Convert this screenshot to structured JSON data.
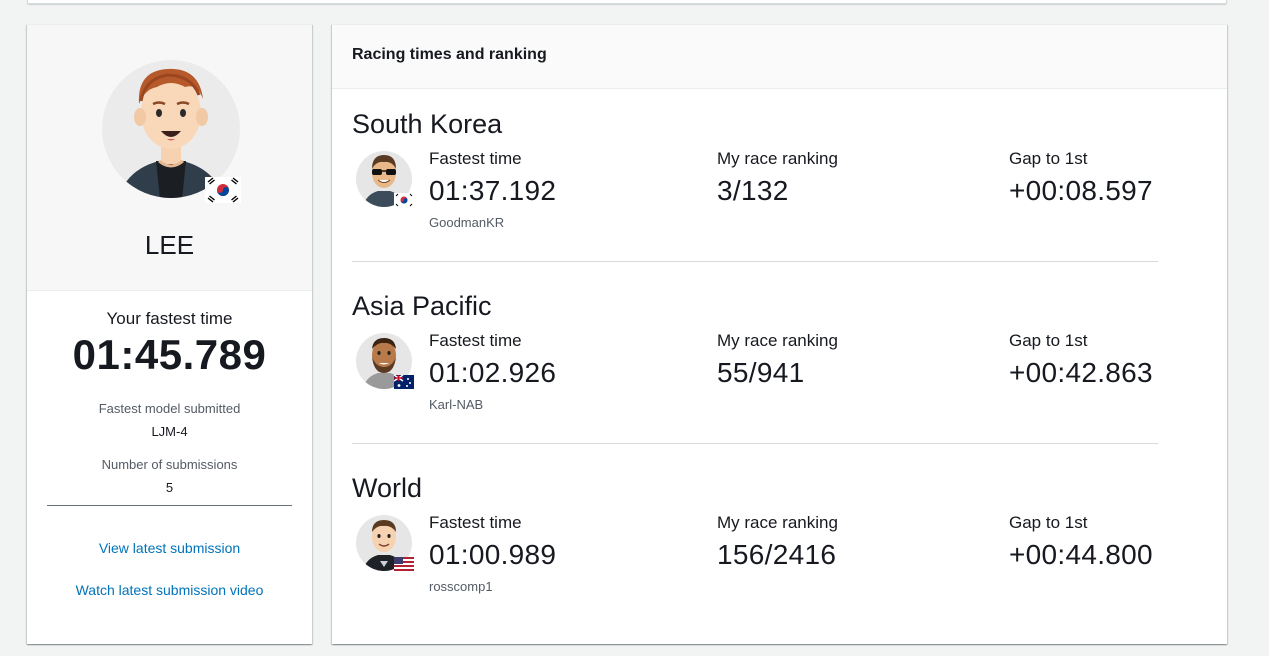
{
  "profile": {
    "name": "LEE",
    "fastest_label": "Your fastest time",
    "fastest_time": "01:45.789",
    "model_label": "Fastest model submitted",
    "model_value": "LJM-4",
    "submissions_label": "Number of submissions",
    "submissions_value": "5",
    "view_latest_link": "View latest submission",
    "watch_video_link": "Watch latest submission video",
    "flag": "south-korea-flag"
  },
  "ranking": {
    "header": "Racing times and ranking",
    "labels": {
      "fastest": "Fastest time",
      "ranking": "My race ranking",
      "gap": "Gap to 1st"
    },
    "sections": [
      {
        "title": "South Korea",
        "fastest_time": "01:37.192",
        "leader": "GoodmanKR",
        "ranking": "3/132",
        "gap": "+00:08.597",
        "flag": "south-korea-flag"
      },
      {
        "title": "Asia Pacific",
        "fastest_time": "01:02.926",
        "leader": "Karl-NAB",
        "ranking": "55/941",
        "gap": "+00:42.863",
        "flag": "australia-flag"
      },
      {
        "title": "World",
        "fastest_time": "01:00.989",
        "leader": "rosscomp1",
        "ranking": "156/2416",
        "gap": "+00:44.800",
        "flag": "usa-flag"
      }
    ]
  },
  "colors": {
    "link": "#0073bb",
    "page_bg": "#f2f3f3",
    "card_bg": "#ffffff",
    "header_bg": "#fafafa"
  }
}
